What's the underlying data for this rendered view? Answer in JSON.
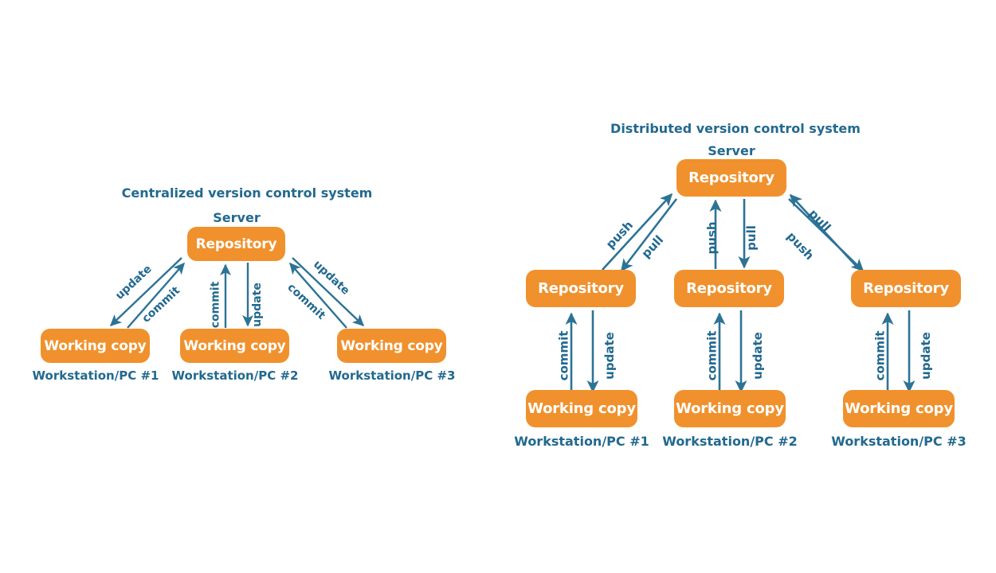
{
  "page": {
    "background": "#ffffff",
    "accent_orange": "#F0912D",
    "accent_blue": "#22698F",
    "arrow_blue": "#2C7396",
    "node_text_color": "#ffffff"
  },
  "diagrams": [
    {
      "id": "centralized",
      "title": "Centralized version control system",
      "server_caption": "Server",
      "server_node": {
        "label": "Repository"
      },
      "clients": [
        {
          "node_label": "Working copy",
          "caption": "Workstation/PC #1"
        },
        {
          "node_label": "Working copy",
          "caption": "Workstation/PC #2"
        },
        {
          "node_label": "Working copy",
          "caption": "Workstation/PC #3"
        }
      ],
      "edges": [
        {
          "label": "update",
          "from": "server",
          "to": "client1",
          "direction": "down-left"
        },
        {
          "label": "commit",
          "from": "client1",
          "to": "server",
          "direction": "up-right"
        },
        {
          "label": "commit",
          "from": "client2",
          "to": "server",
          "direction": "up"
        },
        {
          "label": "update",
          "from": "server",
          "to": "client2",
          "direction": "down"
        },
        {
          "label": "update",
          "from": "server",
          "to": "client3",
          "direction": "down-right"
        },
        {
          "label": "commit",
          "from": "client3",
          "to": "server",
          "direction": "up-left"
        }
      ]
    },
    {
      "id": "distributed",
      "title": "Distributed version control system",
      "server_caption": "Server",
      "server_node": {
        "label": "Repository"
      },
      "clients": [
        {
          "repo_label": "Repository",
          "working_label": "Working copy",
          "caption": "Workstation/PC #1"
        },
        {
          "repo_label": "Repository",
          "working_label": "Working copy",
          "caption": "Workstation/PC #2"
        },
        {
          "repo_label": "Repository",
          "working_label": "Working copy",
          "caption": "Workstation/PC #3"
        }
      ],
      "edges": [
        {
          "label": "push",
          "from": "repo1",
          "to": "server",
          "direction": "up-right"
        },
        {
          "label": "pull",
          "from": "server",
          "to": "repo1",
          "direction": "down-left"
        },
        {
          "label": "push",
          "from": "repo2",
          "to": "server",
          "direction": "up"
        },
        {
          "label": "pull",
          "from": "server",
          "to": "repo2",
          "direction": "down"
        },
        {
          "label": "pull",
          "from": "server",
          "to": "repo3",
          "direction": "down-right"
        },
        {
          "label": "push",
          "from": "repo3",
          "to": "server",
          "direction": "up-left"
        },
        {
          "label": "commit",
          "from": "working1",
          "to": "repo1",
          "direction": "up"
        },
        {
          "label": "update",
          "from": "repo1",
          "to": "working1",
          "direction": "down"
        },
        {
          "label": "commit",
          "from": "working2",
          "to": "repo2",
          "direction": "up"
        },
        {
          "label": "update",
          "from": "repo2",
          "to": "working2",
          "direction": "down"
        },
        {
          "label": "commit",
          "from": "working3",
          "to": "repo3",
          "direction": "up"
        },
        {
          "label": "update",
          "from": "repo3",
          "to": "working3",
          "direction": "down"
        }
      ]
    }
  ]
}
